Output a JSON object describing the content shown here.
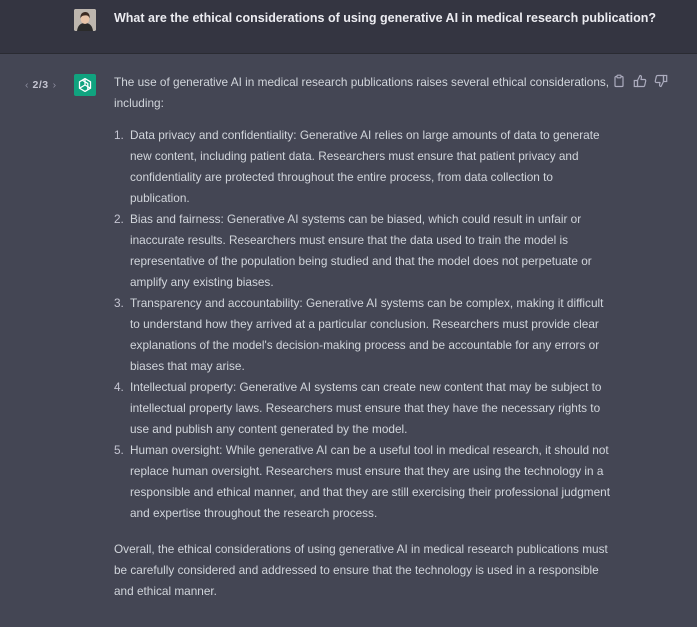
{
  "user": {
    "question": "What are the ethical considerations of using generative AI in medical research publication?"
  },
  "pager": {
    "prev": "‹",
    "count": "2/3",
    "next": "›"
  },
  "icons": {
    "user_avatar": "user-photo",
    "assistant_avatar": "openai-logo",
    "copy": "clipboard-icon",
    "like": "thumbs-up-icon",
    "dislike": "thumbs-down-icon"
  },
  "colors": {
    "user_bg": "#343541",
    "assistant_bg": "#444654",
    "assistant_avatar": "#10a37f",
    "text": "#d1d5db"
  },
  "answer": {
    "intro": "The use of generative AI in medical research publications raises several ethical considerations, including:",
    "items": [
      {
        "num": "1.",
        "text": "Data privacy and confidentiality: Generative AI relies on large amounts of data to generate new content, including patient data. Researchers must ensure that patient privacy and confidentiality are protected throughout the entire process, from data collection to publication."
      },
      {
        "num": "2.",
        "text": "Bias and fairness: Generative AI systems can be biased, which could result in unfair or inaccurate results. Researchers must ensure that the data used to train the model is representative of the population being studied and that the model does not perpetuate or amplify any existing biases."
      },
      {
        "num": "3.",
        "text": "Transparency and accountability: Generative AI systems can be complex, making it difficult to understand how they arrived at a particular conclusion. Researchers must provide clear explanations of the model's decision-making process and be accountable for any errors or biases that may arise."
      },
      {
        "num": "4.",
        "text": "Intellectual property: Generative AI systems can create new content that may be subject to intellectual property laws. Researchers must ensure that they have the necessary rights to use and publish any content generated by the model."
      },
      {
        "num": "5.",
        "text": "Human oversight: While generative AI can be a useful tool in medical research, it should not replace human oversight. Researchers must ensure that they are using the technology in a responsible and ethical manner, and that they are still exercising their professional judgment and expertise throughout the research process."
      }
    ],
    "closing": "Overall, the ethical considerations of using generative AI in medical research publications must be carefully considered and addressed to ensure that the technology is used in a responsible and ethical manner."
  }
}
